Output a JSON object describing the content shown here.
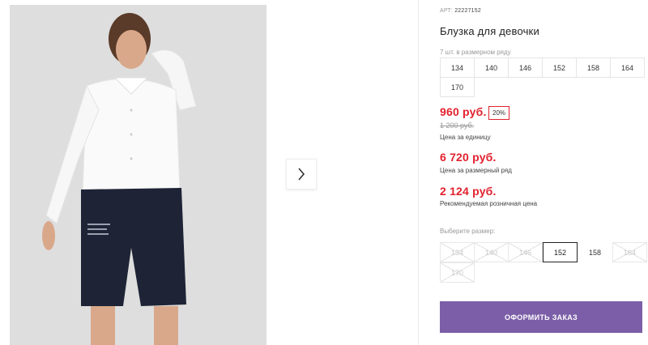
{
  "gallery": {
    "next_icon": "chevron-right-icon"
  },
  "product": {
    "sku_label": "АРТ:",
    "sku_value": "22227152",
    "title": "Блузка для девочки",
    "size_count": "7 шт. в размерном ряду",
    "sizes": [
      "134",
      "140",
      "146",
      "152",
      "158",
      "164",
      "170"
    ]
  },
  "pricing": {
    "price": "960 руб.",
    "discount": "20%",
    "old_price": "1 200 руб.",
    "unit_label": "Цена за единицу",
    "pack_price": "6 720 руб.",
    "pack_label": "Цена за размерный ряд",
    "retail_price": "2 124 руб.",
    "retail_label": "Рекомендуемая розничная цена"
  },
  "size_select": {
    "label": "Выберите размер:",
    "options": [
      {
        "label": "134",
        "state": "disabled"
      },
      {
        "label": "140",
        "state": "disabled"
      },
      {
        "label": "146",
        "state": "disabled"
      },
      {
        "label": "152",
        "state": "selected"
      },
      {
        "label": "158",
        "state": "available"
      },
      {
        "label": "164",
        "state": "disabled"
      },
      {
        "label": "170",
        "state": "disabled"
      }
    ]
  },
  "actions": {
    "order_label": "ОФОРМИТЬ ЗАКАЗ"
  },
  "colors": {
    "accent": "#7b5ea7",
    "price_red": "#e2212e"
  }
}
